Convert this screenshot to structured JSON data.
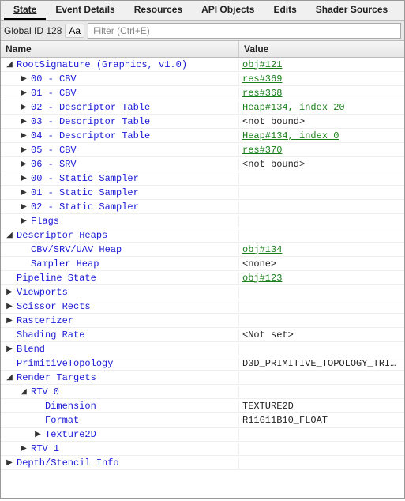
{
  "tabs": [
    {
      "label": "State",
      "active": true
    },
    {
      "label": "Event Details",
      "active": false
    },
    {
      "label": "Resources",
      "active": false
    },
    {
      "label": "API Objects",
      "active": false
    },
    {
      "label": "Edits",
      "active": false
    },
    {
      "label": "Shader Sources",
      "active": false
    }
  ],
  "toolbar": {
    "global_id_label": "Global ID 128",
    "aa_label": "Aa",
    "filter_placeholder": "Filter (Ctrl+E)"
  },
  "columns": {
    "name": "Name",
    "value": "Value"
  },
  "rows": [
    {
      "d": 0,
      "exp": "open",
      "name": "RootSignature (Graphics, v1.0)",
      "val": "obj#121",
      "vt": "link"
    },
    {
      "d": 1,
      "exp": "closed",
      "name": "00 - CBV",
      "val": "res#369",
      "vt": "link"
    },
    {
      "d": 1,
      "exp": "closed",
      "name": "01 - CBV",
      "val": "res#368",
      "vt": "link"
    },
    {
      "d": 1,
      "exp": "closed",
      "name": "02 - Descriptor Table",
      "val": "Heap#134, index 20",
      "vt": "link"
    },
    {
      "d": 1,
      "exp": "closed",
      "name": "03 - Descriptor Table",
      "val": "<not bound>",
      "vt": "plain"
    },
    {
      "d": 1,
      "exp": "closed",
      "name": "04 - Descriptor Table",
      "val": "Heap#134, index 0",
      "vt": "link"
    },
    {
      "d": 1,
      "exp": "closed",
      "name": "05 - CBV",
      "val": "res#370",
      "vt": "link"
    },
    {
      "d": 1,
      "exp": "closed",
      "name": "06 - SRV",
      "val": "<not bound>",
      "vt": "plain"
    },
    {
      "d": 1,
      "exp": "closed",
      "name": "00 - Static Sampler",
      "val": "",
      "vt": "plain"
    },
    {
      "d": 1,
      "exp": "closed",
      "name": "01 - Static Sampler",
      "val": "",
      "vt": "plain"
    },
    {
      "d": 1,
      "exp": "closed",
      "name": "02 - Static Sampler",
      "val": "",
      "vt": "plain"
    },
    {
      "d": 1,
      "exp": "closed",
      "name": "Flags",
      "val": "",
      "vt": "plain"
    },
    {
      "d": 0,
      "exp": "open",
      "name": "Descriptor Heaps",
      "val": "",
      "vt": "plain"
    },
    {
      "d": 1,
      "exp": "none",
      "name": "CBV/SRV/UAV Heap",
      "val": "obj#134",
      "vt": "link"
    },
    {
      "d": 1,
      "exp": "none",
      "name": "Sampler Heap",
      "val": "<none>",
      "vt": "plain"
    },
    {
      "d": 0,
      "exp": "none",
      "name": "Pipeline State",
      "val": "obj#123",
      "vt": "link"
    },
    {
      "d": 0,
      "exp": "closed",
      "name": "Viewports",
      "val": "",
      "vt": "plain"
    },
    {
      "d": 0,
      "exp": "closed",
      "name": "Scissor Rects",
      "val": "",
      "vt": "plain"
    },
    {
      "d": 0,
      "exp": "closed",
      "name": "Rasterizer",
      "val": "",
      "vt": "plain"
    },
    {
      "d": 0,
      "exp": "none",
      "name": "Shading Rate",
      "val": "<Not set>",
      "vt": "plain"
    },
    {
      "d": 0,
      "exp": "closed",
      "name": "Blend",
      "val": "",
      "vt": "plain"
    },
    {
      "d": 0,
      "exp": "none",
      "name": "PrimitiveTopology",
      "val": "D3D_PRIMITIVE_TOPOLOGY_TRI…",
      "vt": "plain"
    },
    {
      "d": 0,
      "exp": "open",
      "name": "Render Targets",
      "val": "",
      "vt": "plain"
    },
    {
      "d": 1,
      "exp": "open",
      "name": "RTV 0",
      "val": "",
      "vt": "plain"
    },
    {
      "d": 2,
      "exp": "none",
      "name": "Dimension",
      "val": "TEXTURE2D",
      "vt": "plain"
    },
    {
      "d": 2,
      "exp": "none",
      "name": "Format",
      "val": "R11G11B10_FLOAT",
      "vt": "plain"
    },
    {
      "d": 2,
      "exp": "closed",
      "name": "Texture2D",
      "val": "",
      "vt": "plain"
    },
    {
      "d": 1,
      "exp": "closed",
      "name": "RTV 1",
      "val": "",
      "vt": "plain"
    },
    {
      "d": 0,
      "exp": "closed",
      "name": "Depth/Stencil Info",
      "val": "",
      "vt": "plain"
    }
  ]
}
